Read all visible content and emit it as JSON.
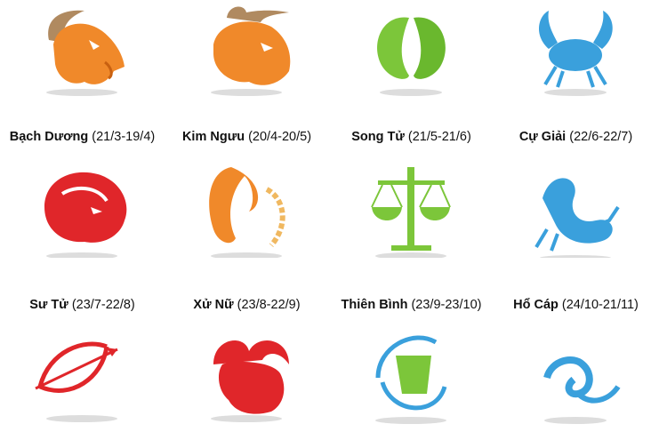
{
  "signs": [
    {
      "name": "Bạch Dương",
      "dates": "(21/3-19/4)",
      "icon": "goat-icon",
      "color": "#f0892a"
    },
    {
      "name": "Kim Ngưu",
      "dates": "(20/4-20/5)",
      "icon": "bull-icon",
      "color": "#f0892a"
    },
    {
      "name": "Song Tử",
      "dates": "(21/5-21/6)",
      "icon": "twins-icon",
      "color": "#7cc63a"
    },
    {
      "name": "Cự Giải",
      "dates": "(22/6-22/7)",
      "icon": "crab-icon",
      "color": "#3aa0dc"
    },
    {
      "name": "Sư Tử",
      "dates": "(23/7-22/8)",
      "icon": "lion-icon",
      "color": "#e0262a"
    },
    {
      "name": "Xử Nữ",
      "dates": "(23/8-22/9)",
      "icon": "maiden-icon",
      "color": "#f0892a"
    },
    {
      "name": "Thiên Bình",
      "dates": "(23/9-23/10)",
      "icon": "scales-icon",
      "color": "#7cc63a"
    },
    {
      "name": "Hổ Cáp",
      "dates": "(24/10-21/11)",
      "icon": "scorpion-icon",
      "color": "#3aa0dc"
    },
    {
      "icon": "archer-bow-icon",
      "color": "#e0262a"
    },
    {
      "icon": "ram-icon",
      "color": "#e0262a"
    },
    {
      "icon": "water-bearer-icon",
      "color": "#3aa0dc"
    },
    {
      "icon": "fish-icon",
      "color": "#3aa0dc"
    }
  ]
}
